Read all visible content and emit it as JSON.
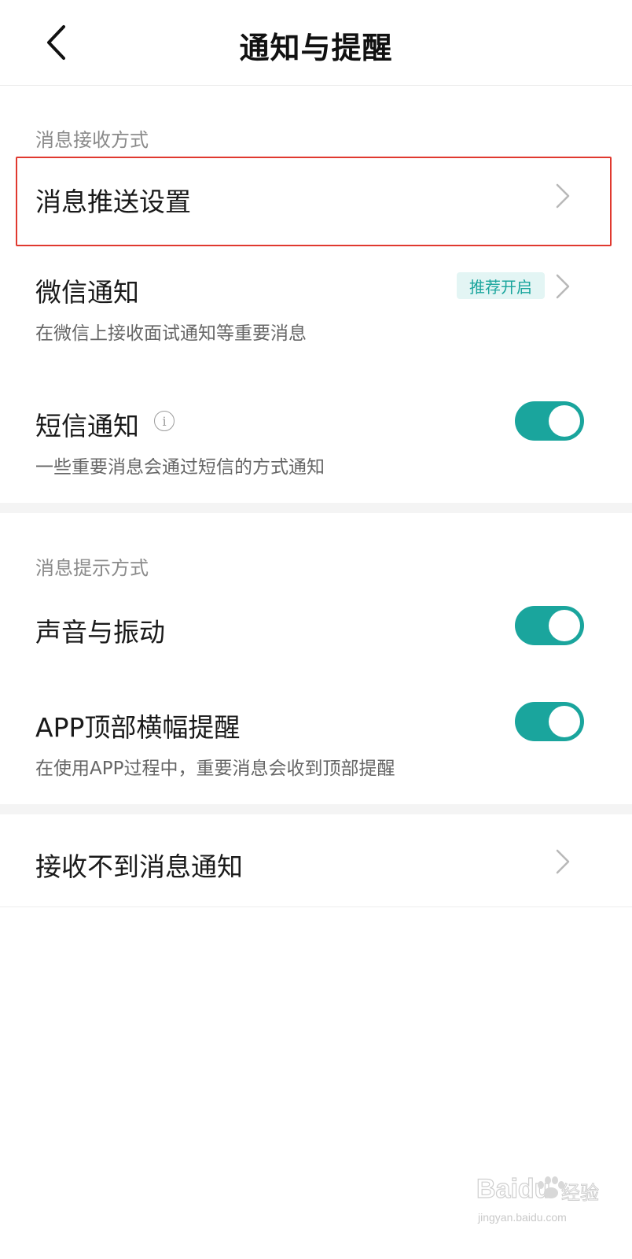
{
  "header": {
    "title": "通知与提醒",
    "back_icon": "chevron-left-icon"
  },
  "section1": {
    "label": "消息接收方式",
    "push_settings": {
      "title": "消息推送设置"
    },
    "wechat": {
      "title": "微信通知",
      "badge": "推荐开启",
      "subtitle": "在微信上接收面试通知等重要消息"
    },
    "sms": {
      "title": "短信通知",
      "info_icon": "i",
      "subtitle": "一些重要消息会通过短信的方式通知",
      "enabled": true
    }
  },
  "section2": {
    "label": "消息提示方式",
    "sound": {
      "title": "声音与振动",
      "enabled": true
    },
    "banner": {
      "title": "APP顶部横幅提醒",
      "subtitle": "在使用APP过程中，重要消息会收到顶部提醒",
      "enabled": true
    }
  },
  "section3": {
    "no_notifications": {
      "title": "接收不到消息通知"
    }
  },
  "colors": {
    "accent": "#1aa59d",
    "highlight": "#e0392f"
  },
  "watermark": {
    "brand": "Baidu",
    "cn": "经验",
    "url": "jingyan.baidu.com"
  }
}
